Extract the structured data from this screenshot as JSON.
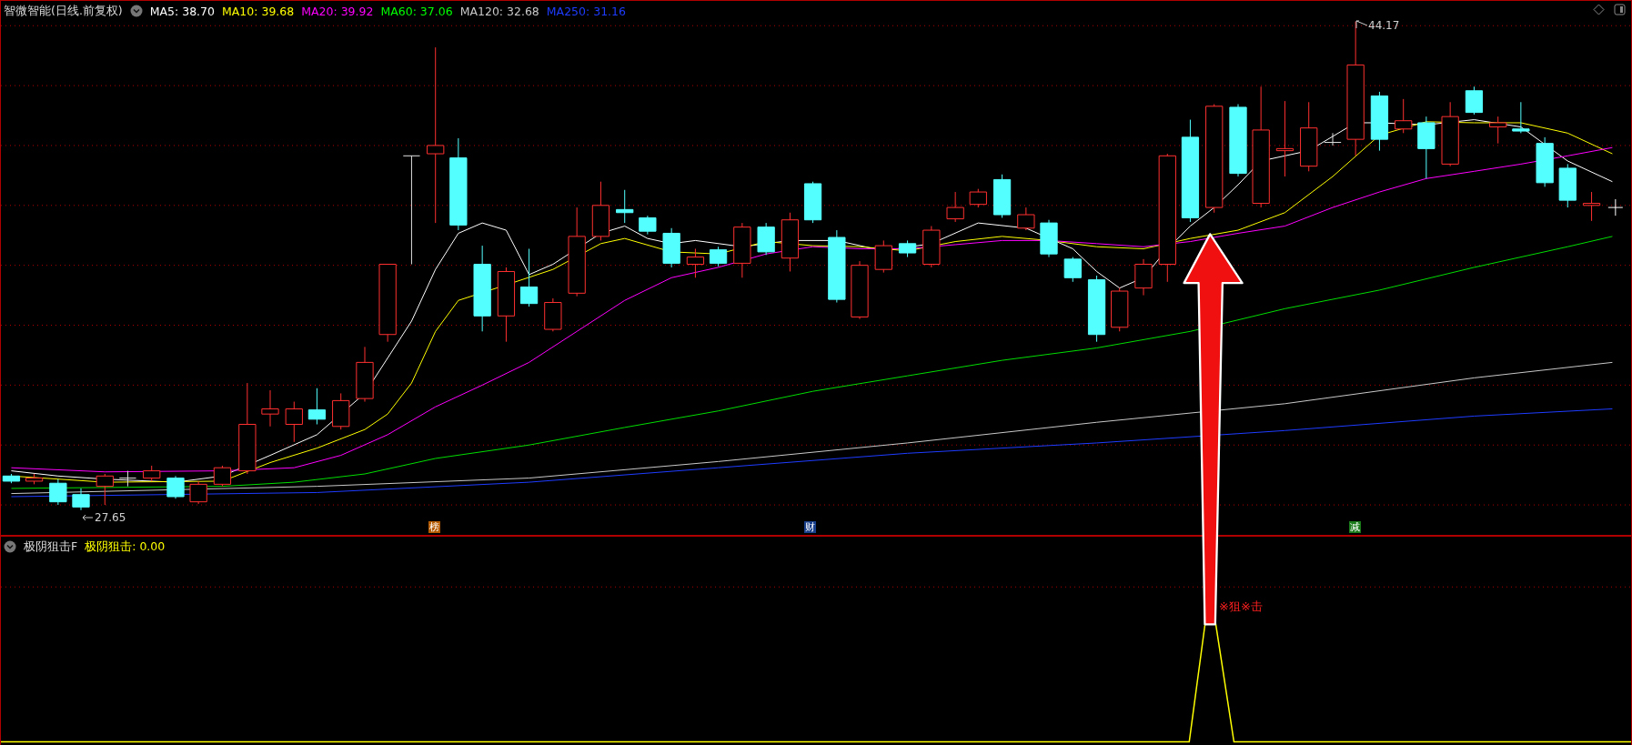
{
  "header": {
    "title": "智微智能(日线.前复权)",
    "indicators": [
      {
        "label": "MA5: 38.70",
        "color": "#ffffff"
      },
      {
        "label": "MA10: 39.68",
        "color": "#ffff00"
      },
      {
        "label": "MA20: 39.92",
        "color": "#ff00ff"
      },
      {
        "label": "MA60: 37.06",
        "color": "#00ff00"
      },
      {
        "label": "MA120: 32.68",
        "color": "#c8c8c8"
      },
      {
        "label": "MA250: 31.16",
        "color": "#1e3cff"
      }
    ]
  },
  "price_chart": {
    "high_label": "44.17",
    "low_label": "27.65",
    "markers": [
      {
        "text": "榜",
        "color": "#b35a00"
      },
      {
        "text": "财",
        "color": "#1a3f8a"
      },
      {
        "text": "减",
        "color": "#1a7a1a"
      }
    ]
  },
  "indicator_panel": {
    "name": "极阴狙击F",
    "reading": "极阴狙击: 0.00",
    "signal_label": "※狙※击"
  }
}
